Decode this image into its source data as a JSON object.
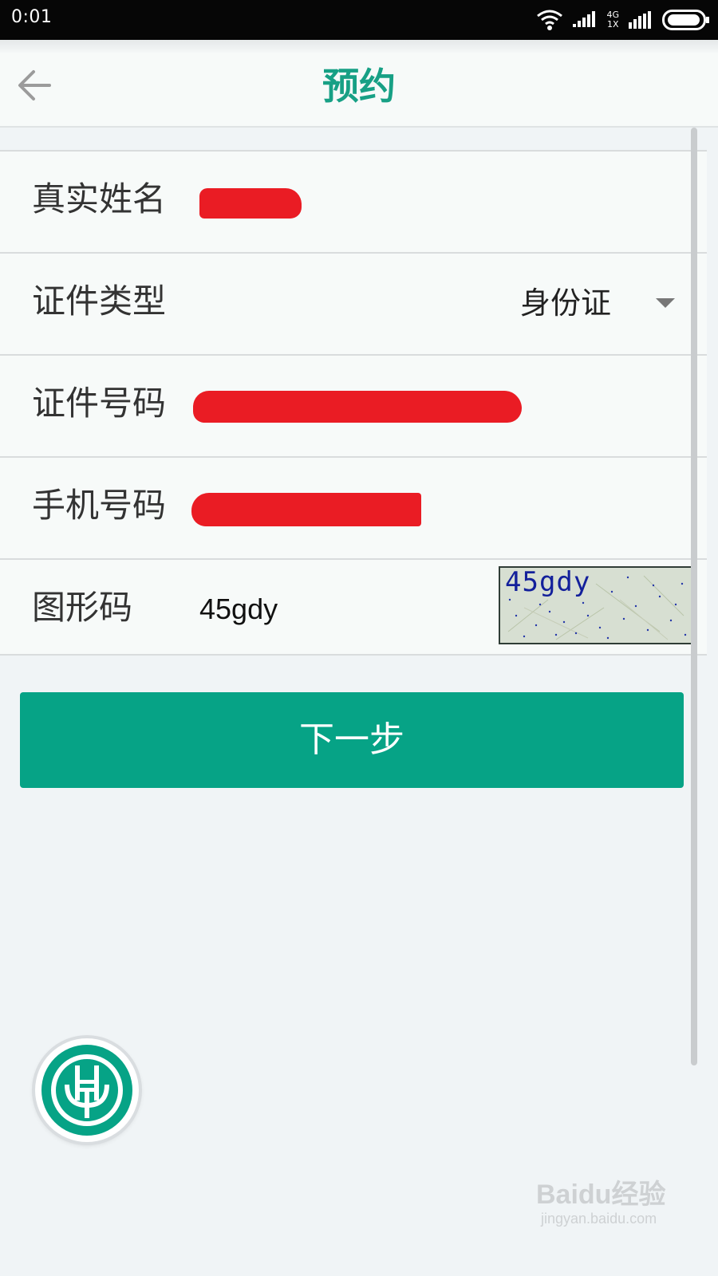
{
  "status_bar": {
    "time": "0:01",
    "network_type_top": "4G",
    "network_type_bottom": "1X",
    "icons": [
      "wifi-icon",
      "signal-bars-icon",
      "battery-icon"
    ]
  },
  "header": {
    "title": "预约",
    "back_icon": "arrow-left-icon"
  },
  "form": {
    "real_name": {
      "label": "真实姓名",
      "value_redacted": true
    },
    "id_type": {
      "label": "证件类型",
      "selected": "身份证",
      "icon": "dropdown-caret-icon"
    },
    "id_number": {
      "label": "证件号码",
      "value_redacted": true
    },
    "phone": {
      "label": "手机号码",
      "value_redacted": true
    },
    "captcha": {
      "label": "图形码",
      "value": "45gdy",
      "image_text": "45gdy"
    }
  },
  "actions": {
    "next_label": "下一步"
  },
  "watermark": {
    "brand": "Baidu经验",
    "url": "jingyan.baidu.com"
  },
  "colors": {
    "accent": "#06a386",
    "title": "#17a085",
    "redaction": "#ea1c24",
    "status_bar": "#060606",
    "background": "#f0f4f6"
  }
}
